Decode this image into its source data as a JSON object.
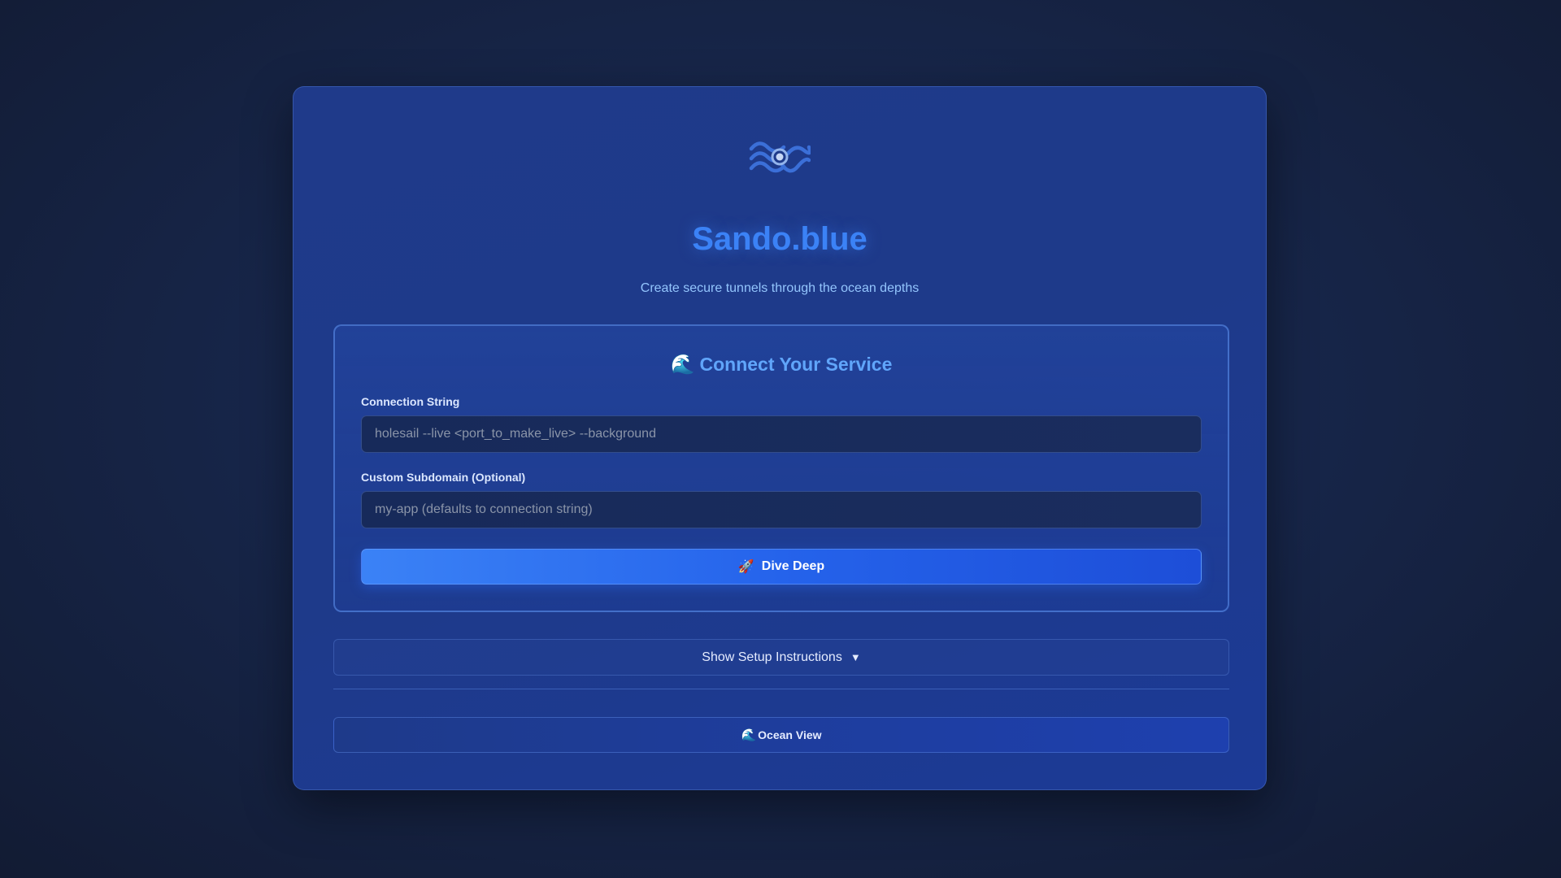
{
  "app": {
    "title": "Sando.blue",
    "subtitle": "Create secure tunnels through the ocean depths",
    "logo_icon": "waves-eye-icon"
  },
  "connect_panel": {
    "heading_icon": "🌊",
    "heading": "Connect Your Service",
    "connection_label": "Connection String",
    "connection_value": "",
    "connection_placeholder": "holesail --live <port_to_make_live> --background",
    "subdomain_label": "Custom Subdomain (Optional)",
    "subdomain_value": "",
    "subdomain_placeholder": "my-app (defaults to connection string)",
    "submit_icon": "🚀",
    "submit_label": "Dive Deep"
  },
  "setup": {
    "toggle_label": "Show Setup Instructions",
    "toggle_icon": "▼"
  },
  "ocean_view": {
    "icon": "🌊",
    "label": "Ocean View"
  },
  "colors": {
    "background": "#17264a",
    "card": "#1e3a8a",
    "accent": "#3b82f6",
    "subtitle": "#93c5fd",
    "button_start": "#3b82f6",
    "button_end": "#1d4ed8"
  }
}
